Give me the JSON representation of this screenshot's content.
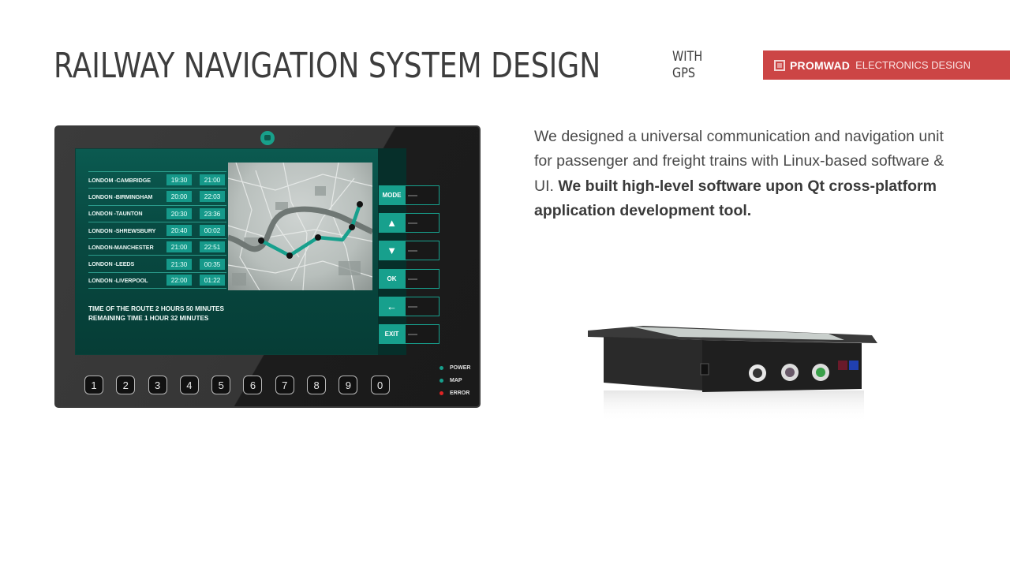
{
  "header": {
    "title": "RAILWAY NAVIGATION SYSTEM DESIGN",
    "subtitle_line1": "WITH",
    "subtitle_line2": "GPS"
  },
  "brand": {
    "name": "PROMWAD",
    "tagline": "ELECTRONICS DESIGN",
    "color": "#cc4545"
  },
  "description": {
    "regular": "We designed a universal communication and navigation unit for passenger and freight trains with Linux-based software & UI. ",
    "bold": "We built high-level software upon Qt cross-platform application development tool."
  },
  "device": {
    "accent_color": "#17a08d",
    "routes": [
      {
        "name": "LONDOM -CAMBRIDGE",
        "depart": "19:30",
        "arrive": "21:00"
      },
      {
        "name": "LONDON -BIRMINGHAM",
        "depart": "20:00",
        "arrive": "22:03"
      },
      {
        "name": "LONDON -TAUNTON",
        "depart": "20:30",
        "arrive": "23:36"
      },
      {
        "name": "LONDON -SHREWSBURY",
        "depart": "20:40",
        "arrive": "00:02"
      },
      {
        "name": "LONDON-MANCHESTER",
        "depart": "21:00",
        "arrive": "22:51"
      },
      {
        "name": "LONDON -LEEDS",
        "depart": "21:30",
        "arrive": "00:35"
      },
      {
        "name": "LONDON -LIVERPOOL",
        "depart": "22:00",
        "arrive": "01:22"
      }
    ],
    "route_time": "TIME OF THE ROUTE 2 HOURS 50 MINUTES",
    "remaining_time": "REMAINING TIME 1 HOUR 32 MINUTES",
    "side_buttons": [
      {
        "label": "MODE",
        "icon": "text"
      },
      {
        "label": "▲",
        "icon": "arrow-up-icon"
      },
      {
        "label": "▼",
        "icon": "arrow-down-icon"
      },
      {
        "label": "OK",
        "icon": "text"
      },
      {
        "label": "←",
        "icon": "arrow-left-icon"
      },
      {
        "label": "EXIT",
        "icon": "text"
      }
    ],
    "keypad": [
      "1",
      "2",
      "3",
      "4",
      "5",
      "6",
      "7",
      "8",
      "9",
      "0"
    ],
    "indicators": [
      {
        "label": "POWER",
        "color": "#17a08d"
      },
      {
        "label": "MAP",
        "color": "#17a08d"
      },
      {
        "label": "ERROR",
        "color": "#e02424"
      }
    ]
  }
}
